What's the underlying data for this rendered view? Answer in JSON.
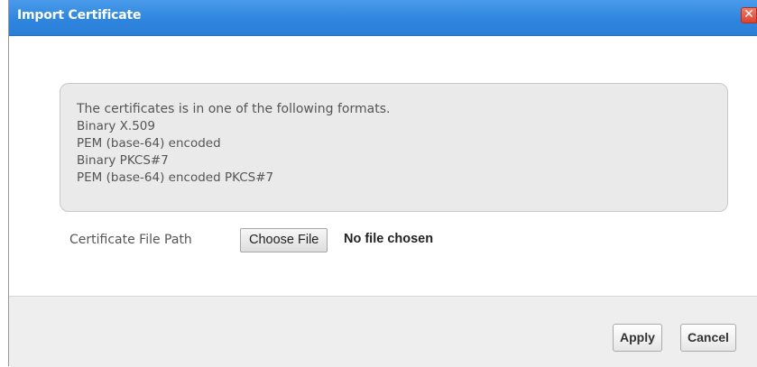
{
  "dialog": {
    "title": "Import Certificate",
    "close_glyph": "✕"
  },
  "info": {
    "lines": [
      "The certificates is in one of the following formats.",
      "Binary X.509",
      "PEM (base-64) encoded",
      "Binary PKCS#7",
      "PEM (base-64) encoded PKCS#7"
    ]
  },
  "file": {
    "label": "Certificate File Path",
    "button_label": "Choose File",
    "status": "No file chosen"
  },
  "footer": {
    "apply_label": "Apply",
    "cancel_label": "Cancel"
  },
  "colors": {
    "title_bar": "#2f86de",
    "close_button": "#d9432f",
    "info_box": "#eaeaea",
    "footer": "#eeeeee"
  },
  "icons": {
    "close": "close-icon"
  }
}
